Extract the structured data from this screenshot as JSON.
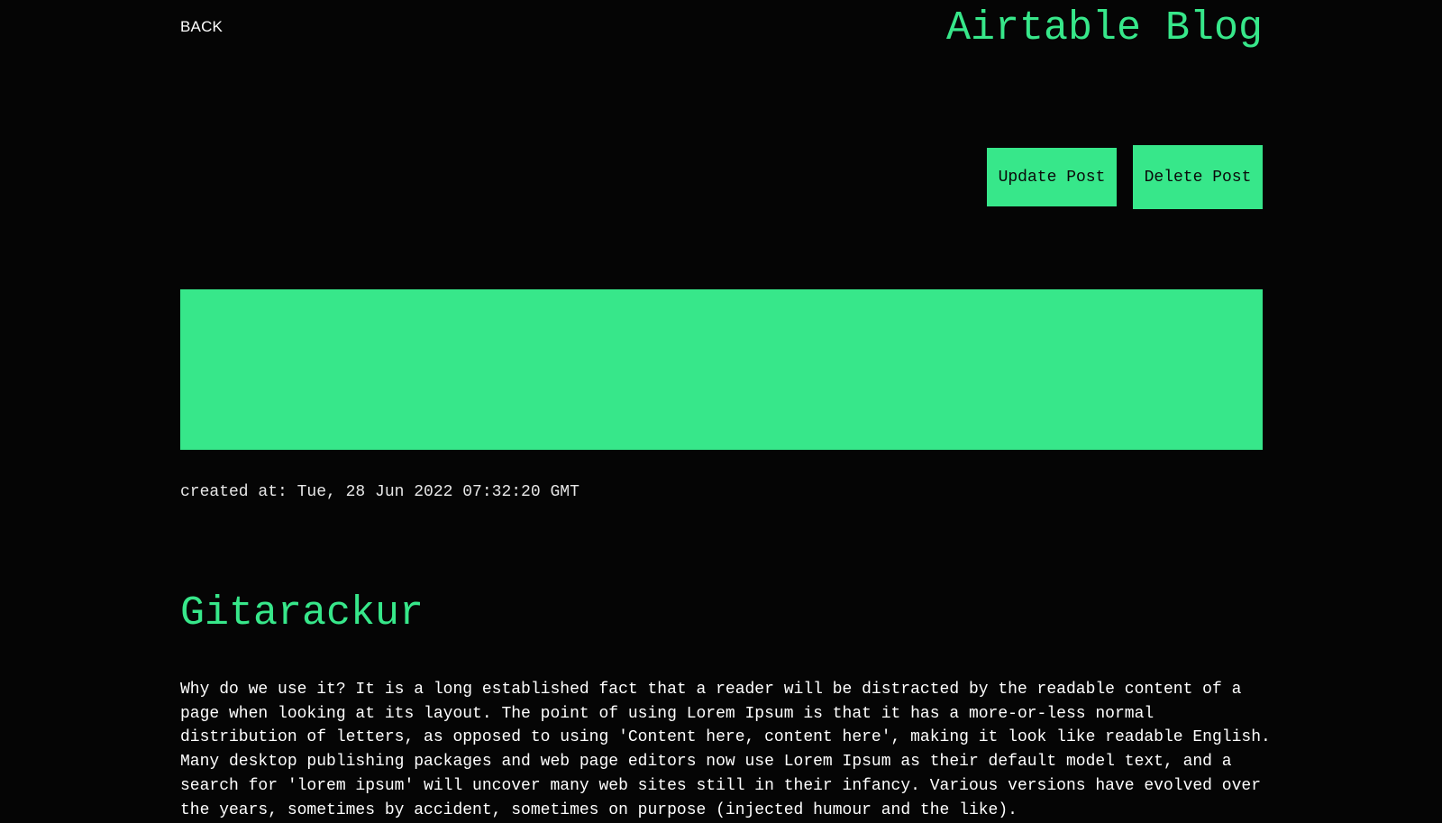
{
  "nav": {
    "back_label": "BACK"
  },
  "header": {
    "title": "Airtable Blog"
  },
  "actions": {
    "update_label": "Update Post",
    "delete_label": "Delete Post"
  },
  "post": {
    "created_at": "created at: Tue, 28 Jun 2022 07:32:20 GMT",
    "title": "Gitarackur",
    "body": "Why do we use it? It is a long established fact that a reader will be distracted by the readable content of a page when looking at its layout. The point of using Lorem Ipsum is that it has a more-or-less normal distribution of letters, as opposed to using 'Content here, content here', making it look like readable English. Many desktop publishing packages and web page editors now use Lorem Ipsum as their default model text, and a search for 'lorem ipsum' will uncover many web sites still in their infancy. Various versions have evolved over the years, sometimes by accident, sometimes on purpose (injected humour and the like)."
  },
  "colors": {
    "background": "#050505",
    "accent": "#37e78a",
    "text": "#ffffff"
  }
}
